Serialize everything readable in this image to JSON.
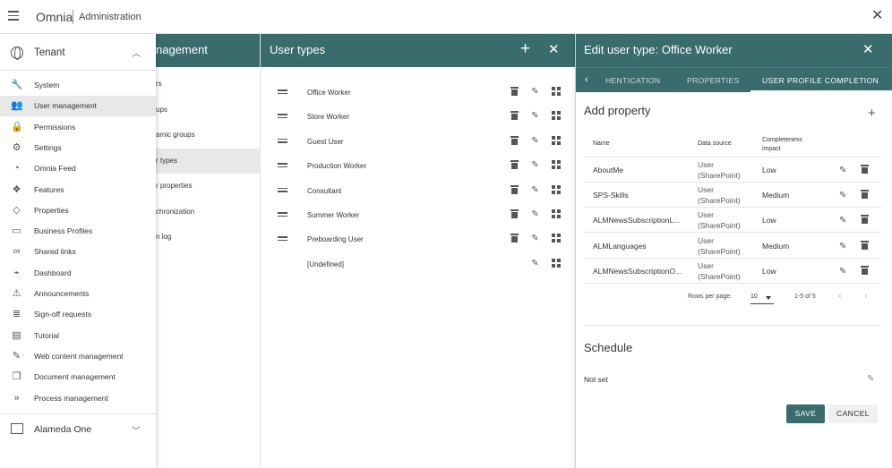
{
  "app": {
    "brand": "Omnia",
    "breadcrumb": "Administration"
  },
  "nav": {
    "tenant_label": "Tenant",
    "items": [
      {
        "label": "System",
        "icon": "wrench-icon"
      },
      {
        "label": "User management",
        "icon": "users-icon",
        "active": true
      },
      {
        "label": "Permissions",
        "icon": "lock-icon"
      },
      {
        "label": "Settings",
        "icon": "gear-icon"
      },
      {
        "label": "Omnia Feed",
        "icon": "rss-icon"
      },
      {
        "label": "Features",
        "icon": "features-icon"
      },
      {
        "label": "Properties",
        "icon": "tag-icon"
      },
      {
        "label": "Business Profiles",
        "icon": "map-icon"
      },
      {
        "label": "Shared links",
        "icon": "link-icon"
      },
      {
        "label": "Dashboard",
        "icon": "chart-icon"
      },
      {
        "label": "Announcements",
        "icon": "warning-icon"
      },
      {
        "label": "Sign-off requests",
        "icon": "list-icon"
      },
      {
        "label": "Tutorial",
        "icon": "book-icon"
      },
      {
        "label": "Web content management",
        "icon": "pen-icon"
      },
      {
        "label": "Document management",
        "icon": "documents-icon"
      },
      {
        "label": "Process management",
        "icon": "double-chevron-icon"
      }
    ],
    "business_profile": "Alameda One"
  },
  "user_management": {
    "title": "nagement",
    "items": [
      "rs",
      "ups",
      "amic groups",
      "r types",
      "r properties",
      "chronization",
      "n log"
    ],
    "active_index": 3
  },
  "user_types": {
    "title": "User types",
    "items": [
      {
        "label": "Office Worker",
        "deletable": true
      },
      {
        "label": "Store Worker",
        "deletable": true
      },
      {
        "label": "Guest User",
        "deletable": true
      },
      {
        "label": "Production Worker",
        "deletable": true
      },
      {
        "label": "Consultant",
        "deletable": true
      },
      {
        "label": "Summer Worker",
        "deletable": true
      },
      {
        "label": "Preboarding User",
        "deletable": true
      },
      {
        "label": "[Undefined]",
        "deletable": false,
        "draggable": false
      }
    ]
  },
  "edit_panel": {
    "title": "Edit user type: Office Worker",
    "tabs": [
      {
        "label": "HENTICATION",
        "active": false
      },
      {
        "label": "PROPERTIES",
        "active": false
      },
      {
        "label": "USER PROFILE COMPLETION",
        "active": true
      }
    ],
    "add_property_heading": "Add property",
    "table": {
      "columns": [
        "Name",
        "Data source",
        "Completeness impact"
      ],
      "rows": [
        {
          "name": "AboutMe",
          "source_line1": "User",
          "source_line2": "(SharePoint)",
          "impact": "Low"
        },
        {
          "name": "SPS-Skills",
          "source_line1": "User",
          "source_line2": "(SharePoint)",
          "impact": "Medium"
        },
        {
          "name": "ALMNewsSubscriptionL...",
          "source_line1": "User",
          "source_line2": "(SharePoint)",
          "impact": "Low"
        },
        {
          "name": "ALMLanguages",
          "source_line1": "User",
          "source_line2": "(SharePoint)",
          "impact": "Medium"
        },
        {
          "name": "ALMNewsSubscriptionO...",
          "source_line1": "User",
          "source_line2": "(SharePoint)",
          "impact": "Low"
        }
      ]
    },
    "pagination": {
      "rows_per_page_label": "Rows per page:",
      "rows_per_page": "10",
      "range": "1-5 of 5"
    },
    "schedule_heading": "Schedule",
    "schedule_value": "Not set",
    "save_label": "SAVE",
    "cancel_label": "CANCEL"
  },
  "colors": {
    "header": "#3a6b6d",
    "active_item": "#e8e8e8"
  }
}
